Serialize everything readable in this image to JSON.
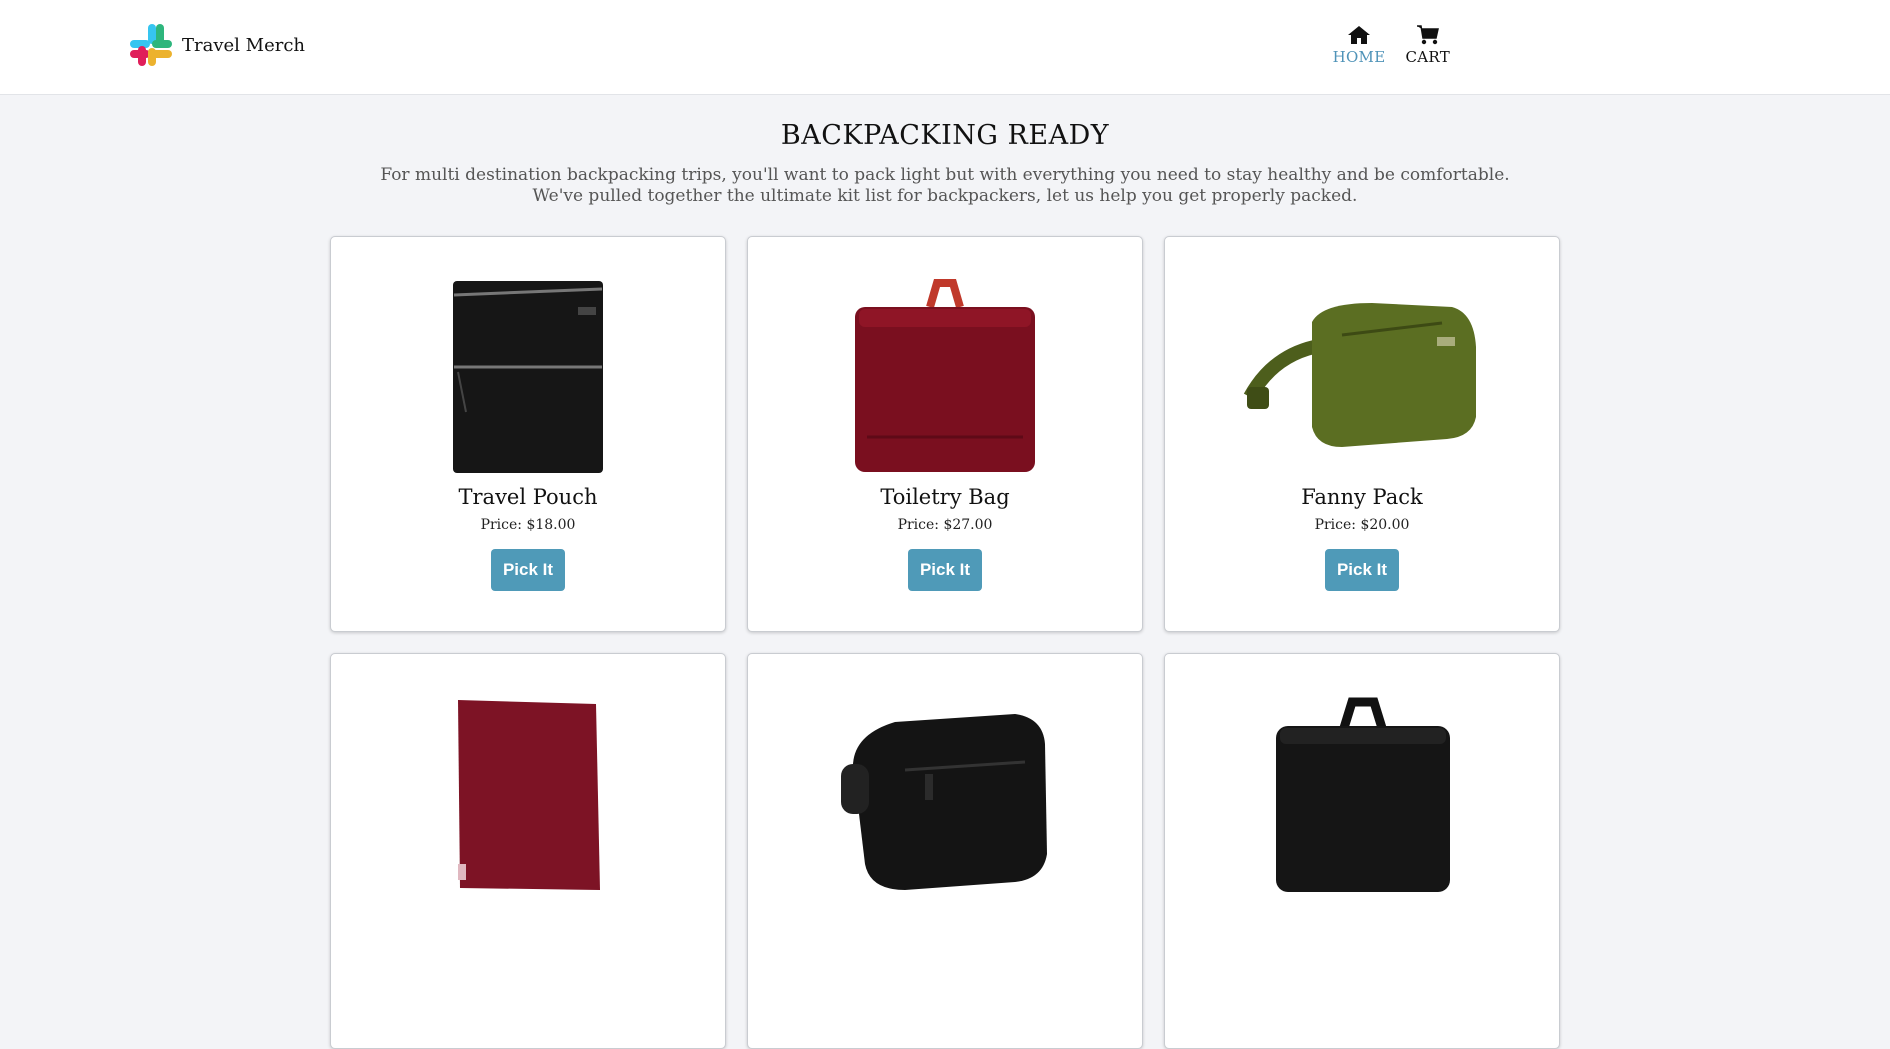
{
  "header": {
    "brand_name": "Travel Merch",
    "nav": [
      {
        "label": "HOME",
        "icon": "home-icon",
        "active": true
      },
      {
        "label": "CART",
        "icon": "cart-icon",
        "active": false
      }
    ]
  },
  "hero": {
    "title": "BACKPACKING READY",
    "line1": "For multi destination backpacking trips, you'll want to pack light but with everything you need to stay healthy and be comfortable.",
    "line2": "We've pulled together the ultimate kit list for backpackers, let us help you get properly packed."
  },
  "products": [
    {
      "name": "Travel Pouch",
      "price": "Price: $18.00",
      "button": "Pick It",
      "image": "black-zip-pouch",
      "color": "#161616"
    },
    {
      "name": "Toiletry Bag",
      "price": "Price: $27.00",
      "button": "Pick It",
      "image": "red-hanging-toiletry-bag",
      "color": "#7a0f1f"
    },
    {
      "name": "Fanny Pack",
      "price": "Price: $20.00",
      "button": "Pick It",
      "image": "green-fanny-pack",
      "color": "#5b6e22"
    },
    {
      "name": "",
      "price": "",
      "button": "",
      "image": "red-pouch",
      "color": "#7d1325"
    },
    {
      "name": "",
      "price": "",
      "button": "",
      "image": "black-dopp-kit",
      "color": "#141414"
    },
    {
      "name": "",
      "price": "",
      "button": "",
      "image": "black-hanging-toiletry-bag",
      "color": "#151515"
    }
  ],
  "colors": {
    "accent": "#4f9ab8",
    "page_bg": "#f3f4f7"
  }
}
